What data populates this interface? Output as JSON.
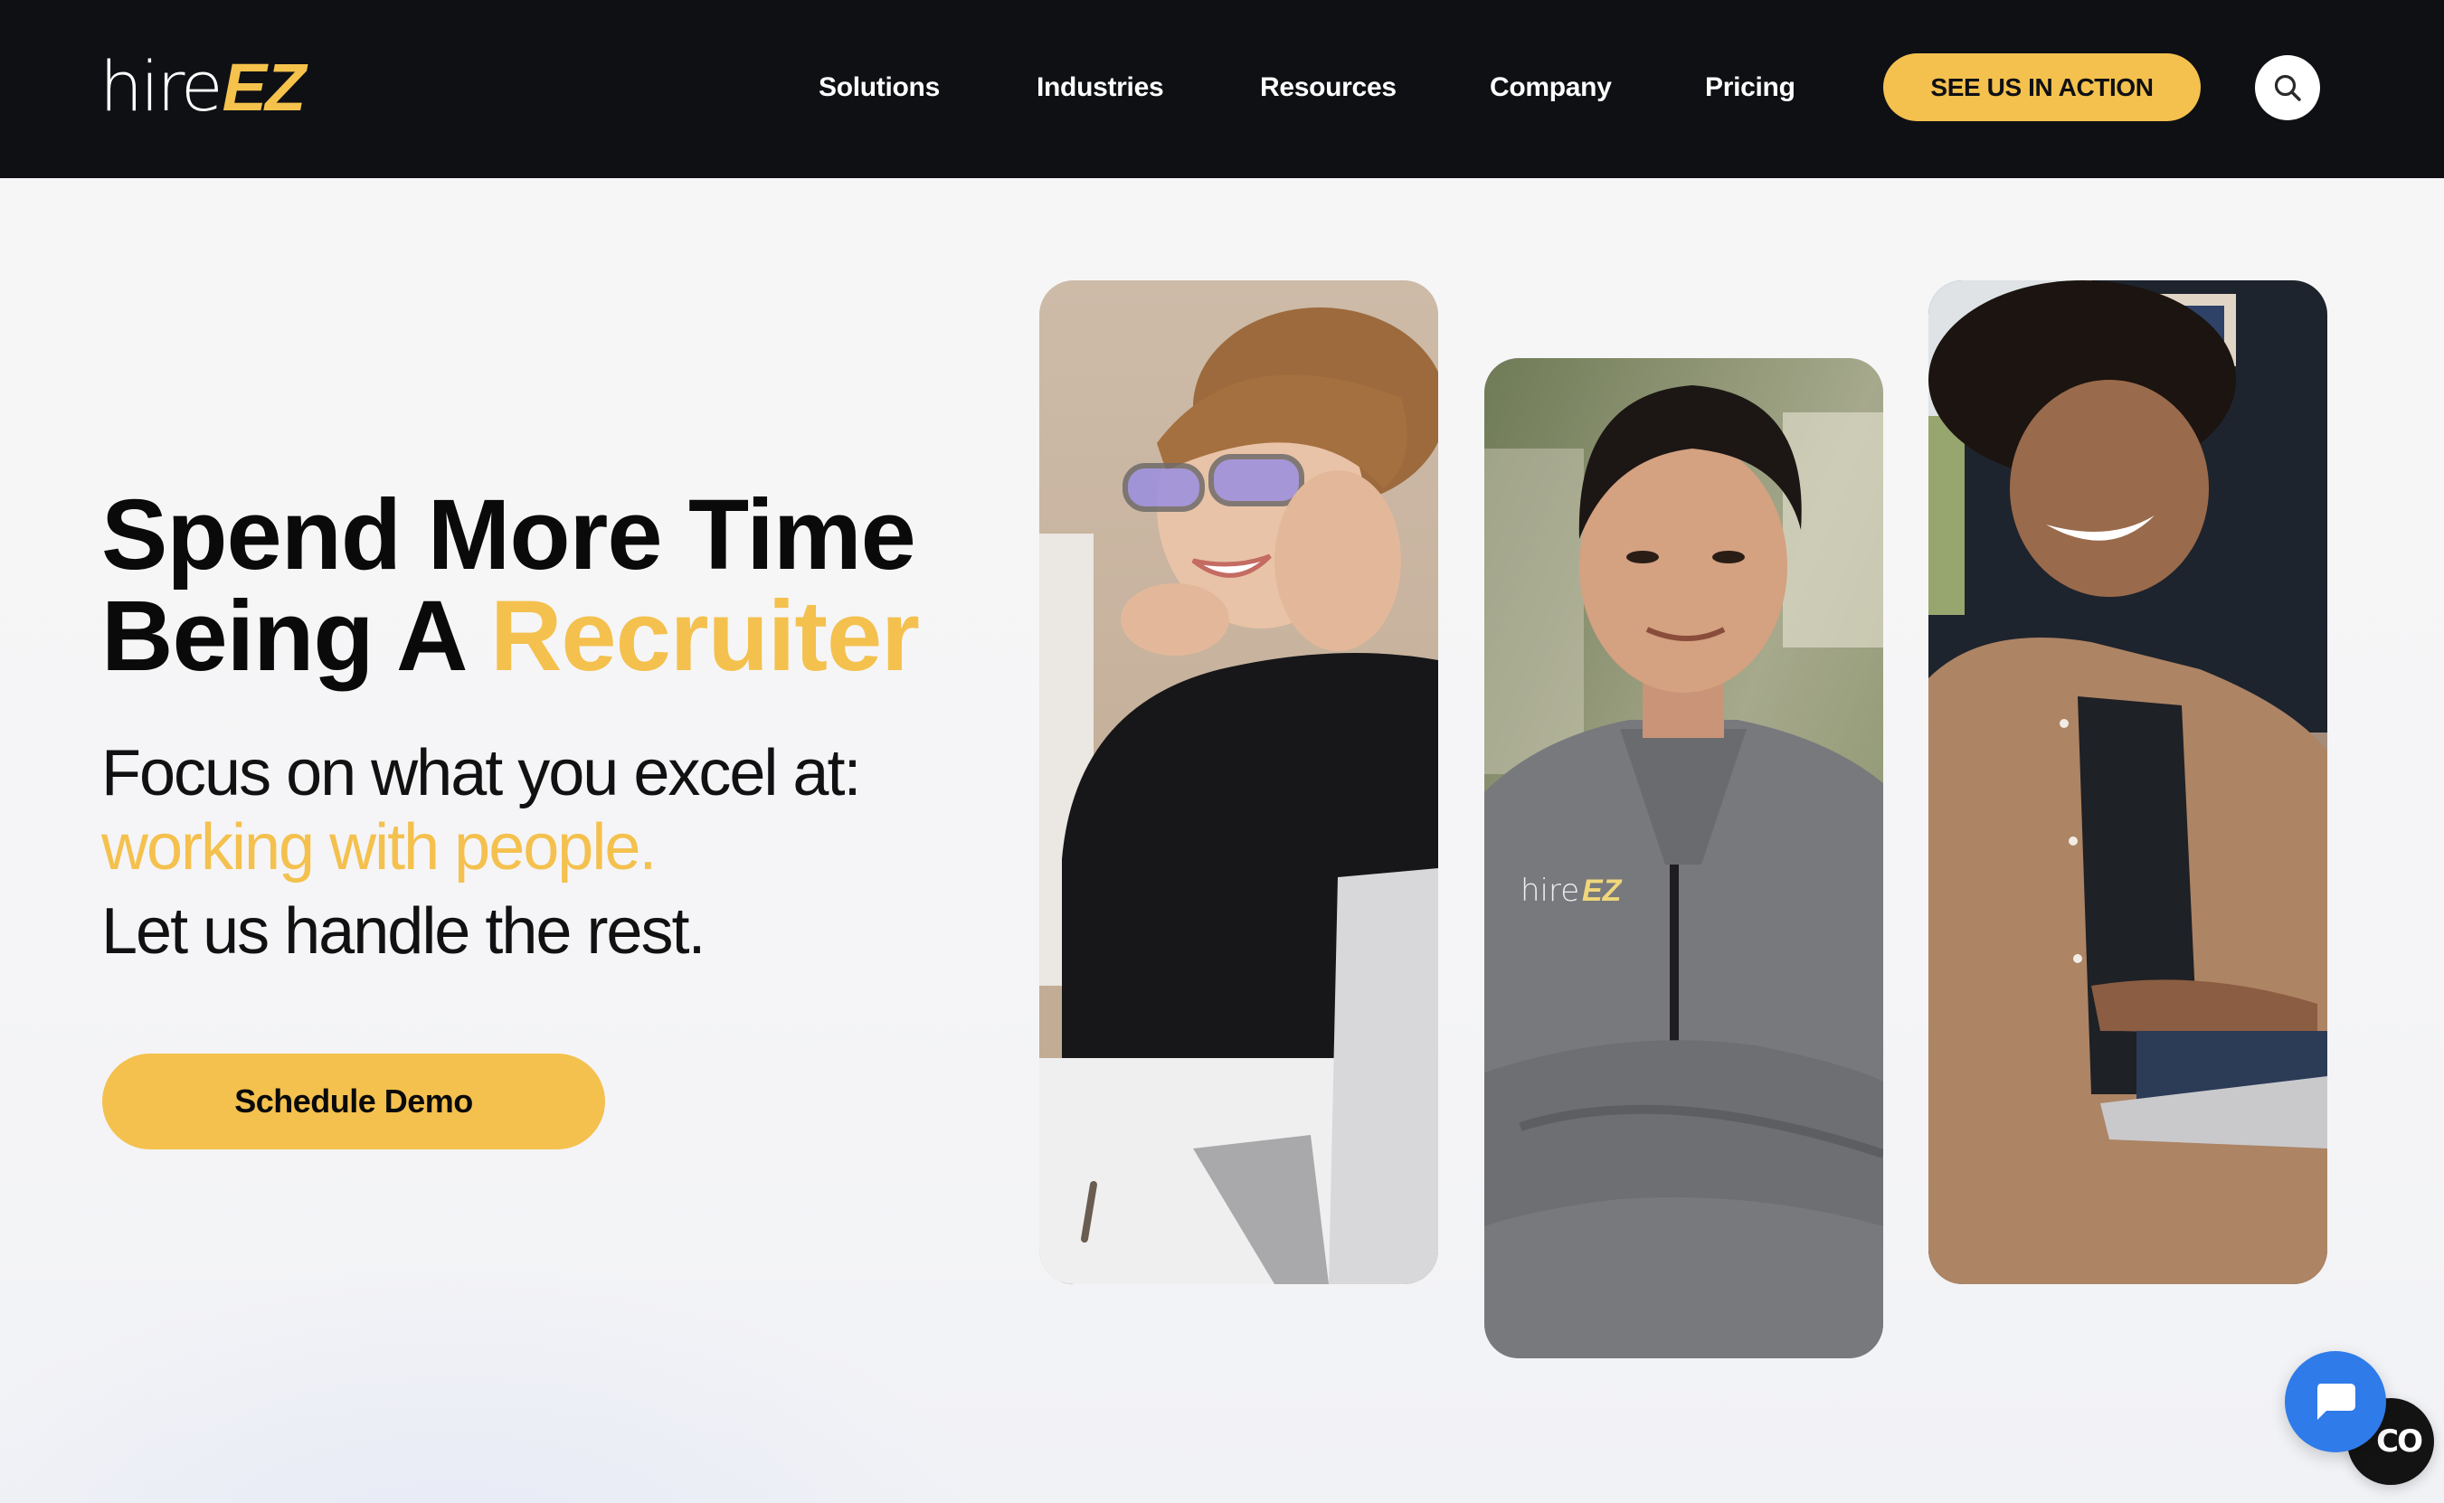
{
  "brand": {
    "logo_part1": "hire",
    "logo_part2": "EZ",
    "accent_color": "#f4c14e",
    "header_bg": "#0f1014"
  },
  "nav": {
    "items": [
      {
        "label": "Solutions"
      },
      {
        "label": "Industries"
      },
      {
        "label": "Resources"
      },
      {
        "label": "Company"
      },
      {
        "label": "Pricing"
      }
    ],
    "cta_label": "SEE US IN ACTION",
    "search_icon": "search-icon"
  },
  "hero": {
    "headline_line1": "Spend More Time",
    "headline_line2_prefix": "Being A ",
    "headline_line2_accent": "Recruiter",
    "sub_line1": "Focus on what you excel at:",
    "sub_line2_accent": "working with people.",
    "sub_line3": "Let us handle the rest.",
    "demo_button_label": "Schedule Demo"
  },
  "photos": [
    {
      "subject": "Smiling woman with glasses resting chin on hands beside laptop"
    },
    {
      "subject": "Smiling man in grey hireEZ quarter-zip with arms crossed",
      "shirt_logo": "hireEZ"
    },
    {
      "subject": "Smiling woman in tan shirt typing on laptop"
    }
  ],
  "widgets": {
    "chat_icon": "chat-bubble-icon",
    "chat_color": "#2f7be9",
    "secondary_label": "CO"
  }
}
